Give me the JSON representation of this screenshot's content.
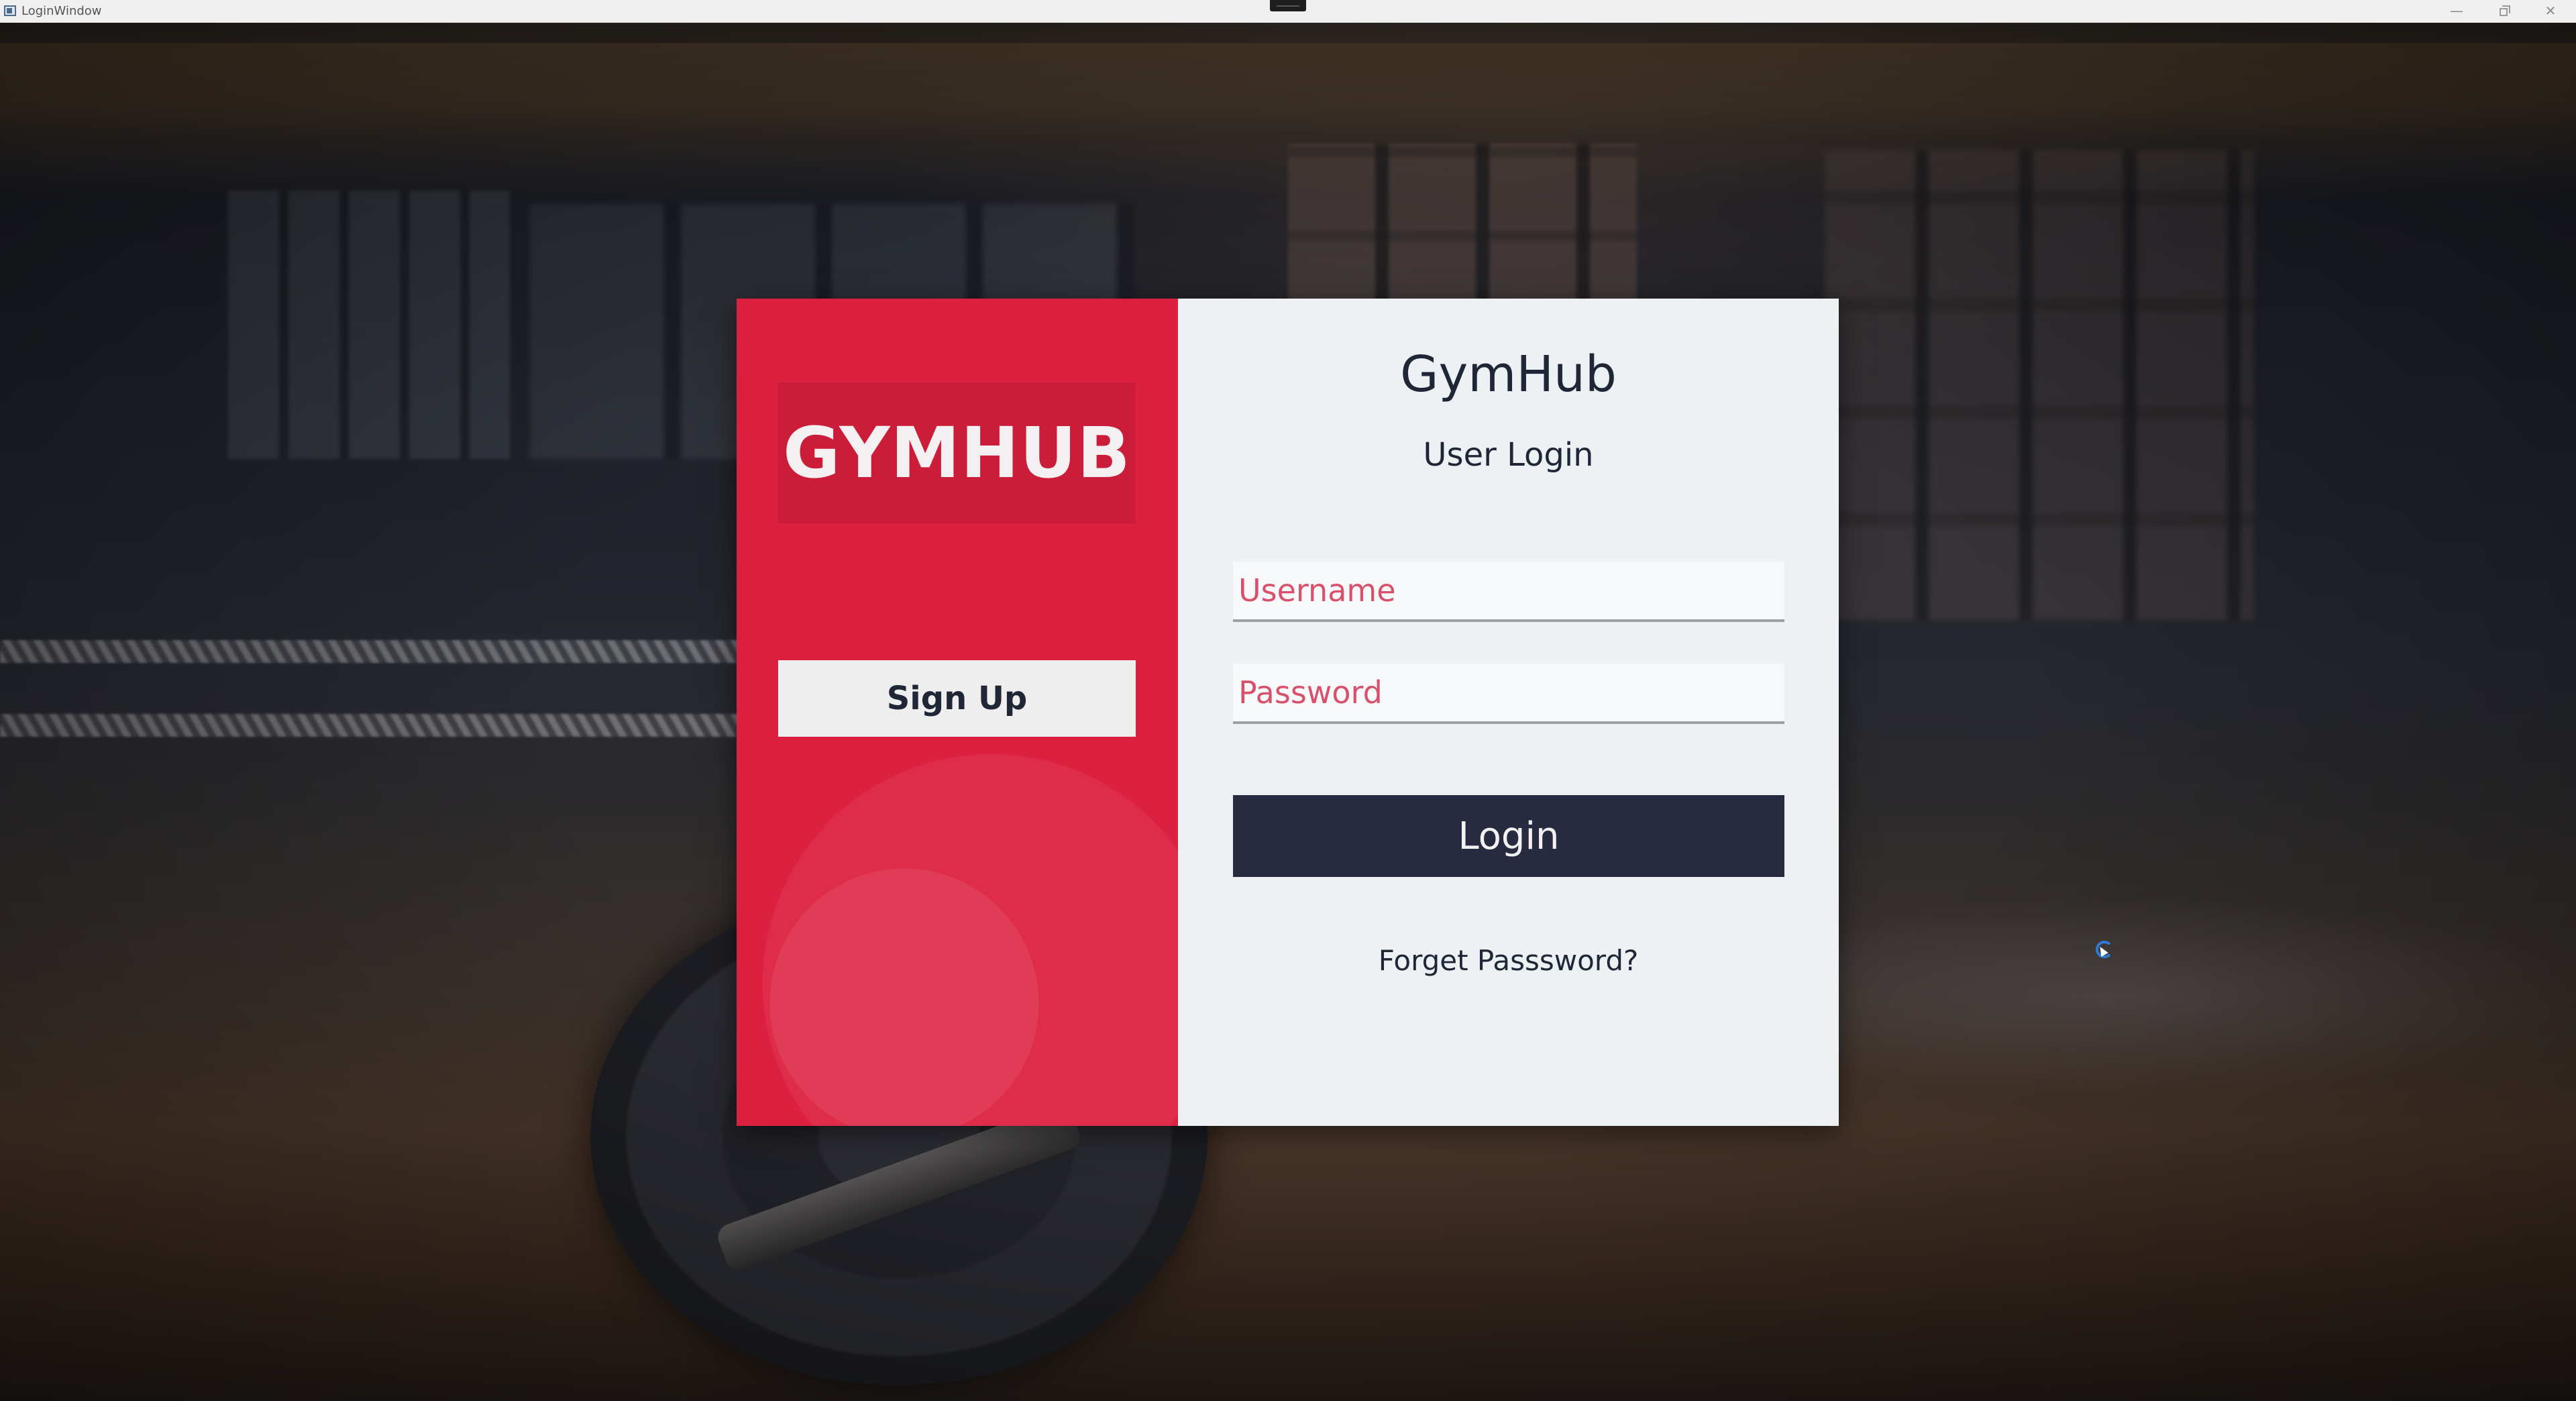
{
  "window": {
    "title": "LoginWindow",
    "controls": {
      "minimize": "—",
      "close": "✕"
    }
  },
  "brand": {
    "logo_text": "GYMHUB",
    "accent_color": "#dc2140",
    "dark_color": "#272b40"
  },
  "left_panel": {
    "signup_label": "Sign Up"
  },
  "login_panel": {
    "app_title": "GymHub",
    "subtitle": "User Login",
    "username": {
      "value": "",
      "placeholder": "Username"
    },
    "password": {
      "value": "",
      "placeholder": "Password"
    },
    "login_label": "Login",
    "forgot_label": "Forget Passsword?"
  }
}
